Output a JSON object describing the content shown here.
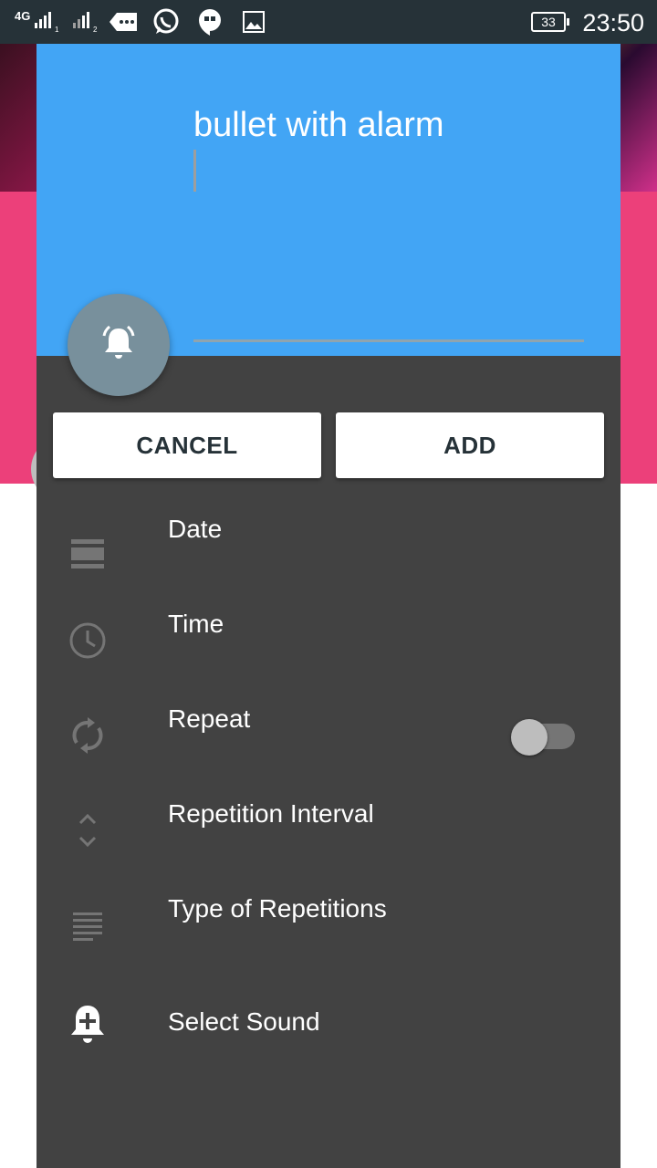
{
  "status_bar": {
    "network_label": "4G",
    "battery_level": "33",
    "time": "23:50",
    "icons": [
      "signal-sim1-icon",
      "signal-sim2-icon",
      "messaging-icon",
      "whatsapp-icon",
      "hangouts-icon",
      "gallery-icon",
      "battery-icon"
    ]
  },
  "dialog": {
    "title_value": "bullet with alarm",
    "fab_icon": "alarm-bell-icon",
    "cancel_label": "CANCEL",
    "add_label": "ADD",
    "header_color": "#42a5f5",
    "body_color": "#424242",
    "items": [
      {
        "label": "Date",
        "icon": "calendar-icon"
      },
      {
        "label": "Time",
        "icon": "clock-icon"
      },
      {
        "label": "Repeat",
        "icon": "repeat-icon"
      },
      {
        "label": "Repetition Interval",
        "icon": "unfold-icon"
      },
      {
        "label": "Type of Repetitions",
        "icon": "lines-icon"
      },
      {
        "label": "Select Sound",
        "icon": "add-alarm-icon"
      }
    ],
    "repeat_toggle_on": false
  }
}
